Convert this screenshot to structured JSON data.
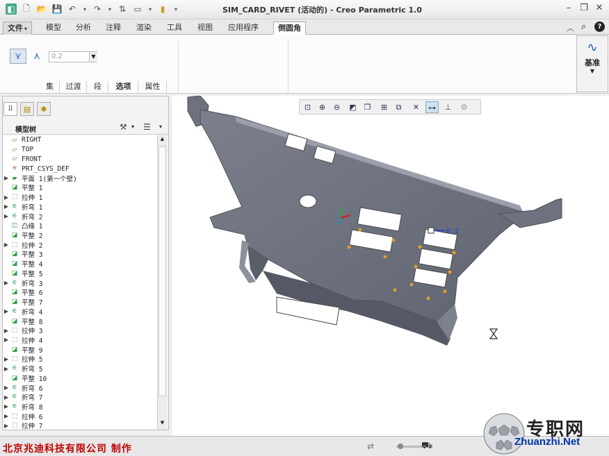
{
  "window": {
    "title": "SIM_CARD_RIVET (活动的) - Creo Parametric 1.0"
  },
  "ribbon": {
    "tabs": [
      {
        "label": "文件",
        "dropdown": "▾"
      },
      {
        "label": "模型"
      },
      {
        "label": "分析"
      },
      {
        "label": "注释"
      },
      {
        "label": "渲染"
      },
      {
        "label": "工具"
      },
      {
        "label": "视图"
      },
      {
        "label": "应用程序"
      },
      {
        "label": "倒圆角",
        "active": true
      }
    ],
    "dimension_value": "0.2",
    "subtabs": [
      "集",
      "过渡",
      "段",
      "选项",
      "属性"
    ],
    "active_subtab": "选项",
    "datum_label": "基准"
  },
  "model_tree": {
    "title": "模型树",
    "items": [
      {
        "label": "RIGHT",
        "icon": "datum-plane-icon",
        "expandable": false
      },
      {
        "label": "TOP",
        "icon": "datum-plane-icon",
        "expandable": false
      },
      {
        "label": "FRONT",
        "icon": "datum-plane-icon",
        "expandable": false
      },
      {
        "label": "PRT_CSYS_DEF",
        "icon": "csys-icon",
        "expandable": false
      },
      {
        "label": "平面 1(第一个壁)",
        "icon": "plane-wall-icon",
        "expandable": true
      },
      {
        "label": "平整 1",
        "icon": "flat-wall-icon",
        "expandable": false
      },
      {
        "label": "拉伸 1",
        "icon": "extrude-icon",
        "expandable": true
      },
      {
        "label": "折弯 1",
        "icon": "bend-icon",
        "expandable": true
      },
      {
        "label": "折弯 2",
        "icon": "bend-icon",
        "expandable": true
      },
      {
        "label": "凸缘 1",
        "icon": "flange-icon",
        "expandable": false
      },
      {
        "label": "平整 2",
        "icon": "flat-wall-icon",
        "expandable": false
      },
      {
        "label": "拉伸 2",
        "icon": "extrude-icon",
        "expandable": true
      },
      {
        "label": "平整 3",
        "icon": "flat-wall-icon",
        "expandable": false
      },
      {
        "label": "平整 4",
        "icon": "flat-wall-icon",
        "expandable": false
      },
      {
        "label": "平整 5",
        "icon": "flat-wall-icon",
        "expandable": false
      },
      {
        "label": "折弯 3",
        "icon": "bend-icon",
        "expandable": true
      },
      {
        "label": "平整 6",
        "icon": "flat-wall-icon",
        "expandable": false
      },
      {
        "label": "平整 7",
        "icon": "flat-wall-icon",
        "expandable": false
      },
      {
        "label": "折弯 4",
        "icon": "bend-icon",
        "expandable": true
      },
      {
        "label": "平整 8",
        "icon": "flat-wall-icon",
        "expandable": false
      },
      {
        "label": "拉伸 3",
        "icon": "extrude-icon",
        "expandable": true
      },
      {
        "label": "拉伸 4",
        "icon": "extrude-icon",
        "expandable": true
      },
      {
        "label": "平整 9",
        "icon": "flat-wall-icon",
        "expandable": false
      },
      {
        "label": "拉伸 5",
        "icon": "extrude-icon",
        "expandable": true
      },
      {
        "label": "折弯 5",
        "icon": "bend-icon",
        "expandable": true
      },
      {
        "label": "平整 10",
        "icon": "flat-wall-icon",
        "expandable": false
      },
      {
        "label": "折弯 6",
        "icon": "bend-icon",
        "expandable": true
      },
      {
        "label": "折弯 7",
        "icon": "bend-icon",
        "expandable": true
      },
      {
        "label": "折弯 8",
        "icon": "bend-icon",
        "expandable": true
      },
      {
        "label": "拉伸 6",
        "icon": "extrude-icon",
        "expandable": true
      },
      {
        "label": "拉伸 7",
        "icon": "extrude-icon",
        "expandable": true
      }
    ]
  },
  "graphics": {
    "fillet_dim_label": "0.2",
    "model_color": "#6d727e"
  },
  "footer": {
    "company_text": "北京兆迪科技有限公司   制作"
  },
  "watermark": {
    "cn": "专职网",
    "en": "Zhuanzhi.Net"
  }
}
